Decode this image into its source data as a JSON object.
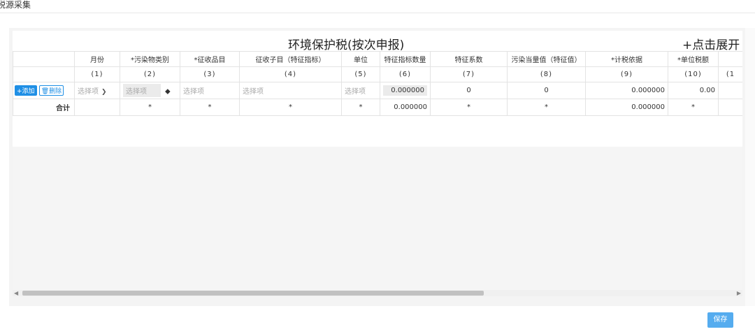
{
  "page": {
    "title": "税源采集"
  },
  "grid": {
    "title": "环境保护税(按次申报)",
    "expand_label": "+点击展开",
    "headers": [
      "",
      "月份",
      "*污染物类别",
      "*征收品目",
      "征收子目（特征指标）",
      "单位",
      "特征指标数量",
      "特征系数",
      "污染当量值（特征值）",
      "*计税依据",
      "*单位税额",
      ""
    ],
    "numbers": [
      "",
      "(1)",
      "(2)",
      "(3)",
      "(4)",
      "(5)",
      "(6)",
      "(7)",
      "(8)",
      "(9)",
      "(10)",
      "(1"
    ],
    "input_row": {
      "add_label": "+添加",
      "delete_label": "删除",
      "month_placeholder": "选择项",
      "pollutant_placeholder": "选择项",
      "item_placeholder": "选择项",
      "subitem_placeholder": "选择项",
      "unit_placeholder": "选择项",
      "quantity": "0.000000",
      "coefficient": "0",
      "equivalent": "0",
      "tax_basis": "0.000000",
      "unit_tax": "0.00"
    },
    "total_row": {
      "label": "合计",
      "c2": "*",
      "c3": "*",
      "c4": "*",
      "c5": "*",
      "c6": "0.000000",
      "c7": "*",
      "c8": "*",
      "c9": "0.000000",
      "c10": "*"
    }
  },
  "actions": {
    "save_label": "保存"
  },
  "icons": {
    "month_dropdown": "chevron-down-icon",
    "upload": "upload-icon",
    "delete": "trash-icon",
    "scroll_left": "arrow-left-icon",
    "scroll_right": "arrow-right-icon"
  },
  "colors": {
    "primary": "#1f8fe5",
    "save_button": "#55acef"
  }
}
